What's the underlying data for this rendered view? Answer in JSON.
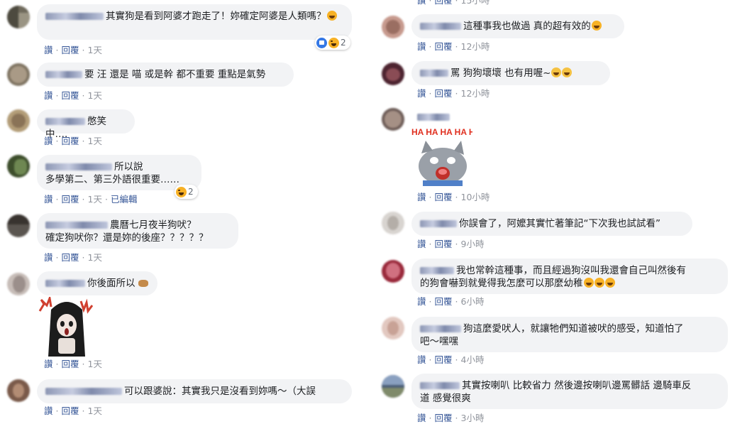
{
  "actions": {
    "like": "讚",
    "reply": "回覆",
    "edited": "已編輯"
  },
  "left_comments": [
    {
      "text": "其實狗是看到阿婆才跑走了！妳確定阿婆是人類嗎？",
      "time": "1天",
      "reaction_count": "2"
    },
    {
      "text": "要 汪 還是 喵 或是幹 都不重要 重點是氣勢",
      "time": "1天"
    },
    {
      "text": "憋笑中….",
      "time": "1天"
    },
    {
      "text_line1": "所以說",
      "text_line2": "多學第二、第三外語很重要……",
      "time": "1天",
      "reaction_count": "2"
    },
    {
      "text_line1": "農曆七月夜半狗吠？",
      "text_line2": "確定狗吠你？還是妳的後座？？？？？",
      "time": "1天"
    },
    {
      "text": "你後面所以",
      "time": "1天"
    },
    {
      "text": "可以跟婆說：其實我只是沒看到妳嗎～（大誤",
      "time": "1天"
    }
  ],
  "right_comments": [
    {
      "text": "這種事我也做過 真的超有效的",
      "time": "12小時"
    },
    {
      "text": "罵 狗狗壞壞 也有用喔~",
      "time": "12小時"
    },
    {
      "sticker_text": "HA HA HA HA HA HA",
      "time": "10小時"
    },
    {
      "text": "你誤會了，阿嬤其實忙著筆記“下次我也試試看”",
      "time": "9小時"
    },
    {
      "text_line1": "我也常幹這種事，而且經過狗沒叫我還會自己叫然後有",
      "text_line2": "的狗會嚇到就覺得我怎麼可以那麼幼稚",
      "time": "6小時"
    },
    {
      "text_line1": "狗這麼愛吠人，就讓牠們知道被吠的感受，知道怕了",
      "text_line2": "吧～嘿嘿",
      "time": "4小時"
    },
    {
      "text_line1": "其實按喇叭 比較省力 然後邊按喇叭邊罵髒話 邊騎車反",
      "text_line2": "道 感覺很爽",
      "time": "3小時"
    }
  ],
  "colors": {
    "bubble": "#f2f3f5",
    "link": "#385898",
    "meta": "#90949c"
  }
}
